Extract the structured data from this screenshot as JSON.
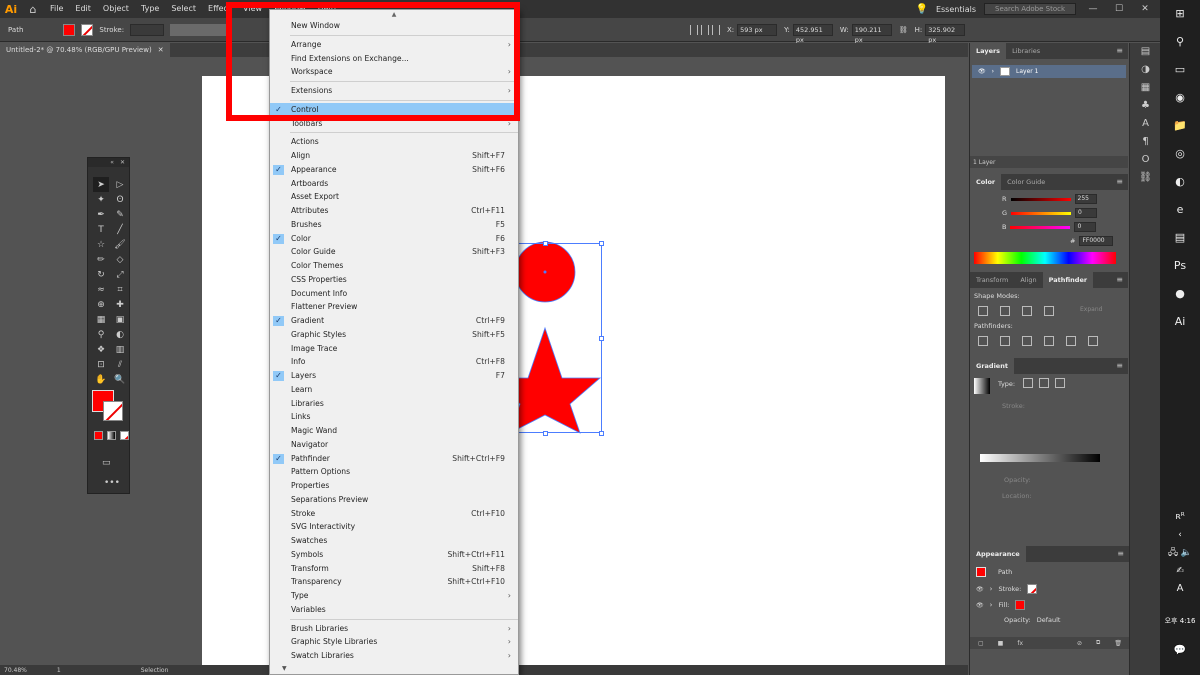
{
  "app": {
    "logo": "Ai",
    "menus": [
      "File",
      "Edit",
      "Object",
      "Type",
      "Select",
      "Effect",
      "View",
      "Window",
      "Help"
    ],
    "workspace": "Essentials",
    "search_placeholder": "Search Adobe Stock"
  },
  "control": {
    "selection_label": "Path",
    "stroke_label": "Stroke:",
    "x_label": "X:",
    "x": "593 px",
    "y_label": "Y:",
    "y": "452.951 px",
    "w_label": "W:",
    "w": "190.211 px",
    "h_label": "H:",
    "h": "325.902 px"
  },
  "document": {
    "tab_title": "Untitled-2* @ 70.48% (RGB/GPU Preview)",
    "zoom": "70.48%",
    "artboard_num": "1",
    "status": "Selection"
  },
  "window_menu": [
    {
      "label": "New Window"
    },
    {
      "sep": true
    },
    {
      "label": "Arrange",
      "sub": true
    },
    {
      "label": "Find Extensions on Exchange..."
    },
    {
      "label": "Workspace",
      "sub": true
    },
    {
      "sep": true
    },
    {
      "label": "Extensions",
      "sub": true
    },
    {
      "sep": true
    },
    {
      "label": "Control",
      "checked": true,
      "hl": true
    },
    {
      "label": "Toolbars",
      "sub": true
    },
    {
      "sep": true
    },
    {
      "label": "Actions"
    },
    {
      "label": "Align",
      "shortcut": "Shift+F7"
    },
    {
      "label": "Appearance",
      "shortcut": "Shift+F6",
      "checked": true
    },
    {
      "label": "Artboards"
    },
    {
      "label": "Asset Export"
    },
    {
      "label": "Attributes",
      "shortcut": "Ctrl+F11"
    },
    {
      "label": "Brushes",
      "shortcut": "F5"
    },
    {
      "label": "Color",
      "shortcut": "F6",
      "checked": true
    },
    {
      "label": "Color Guide",
      "shortcut": "Shift+F3"
    },
    {
      "label": "Color Themes"
    },
    {
      "label": "CSS Properties"
    },
    {
      "label": "Document Info"
    },
    {
      "label": "Flattener Preview"
    },
    {
      "label": "Gradient",
      "shortcut": "Ctrl+F9",
      "checked": true
    },
    {
      "label": "Graphic Styles",
      "shortcut": "Shift+F5"
    },
    {
      "label": "Image Trace"
    },
    {
      "label": "Info",
      "shortcut": "Ctrl+F8"
    },
    {
      "label": "Layers",
      "shortcut": "F7",
      "checked": true
    },
    {
      "label": "Learn"
    },
    {
      "label": "Libraries"
    },
    {
      "label": "Links"
    },
    {
      "label": "Magic Wand"
    },
    {
      "label": "Navigator"
    },
    {
      "label": "Pathfinder",
      "shortcut": "Shift+Ctrl+F9",
      "checked": true
    },
    {
      "label": "Pattern Options"
    },
    {
      "label": "Properties"
    },
    {
      "label": "Separations Preview"
    },
    {
      "label": "Stroke",
      "shortcut": "Ctrl+F10"
    },
    {
      "label": "SVG Interactivity"
    },
    {
      "label": "Swatches"
    },
    {
      "label": "Symbols",
      "shortcut": "Shift+Ctrl+F11"
    },
    {
      "label": "Transform",
      "shortcut": "Shift+F8"
    },
    {
      "label": "Transparency",
      "shortcut": "Shift+Ctrl+F10"
    },
    {
      "label": "Type",
      "sub": true
    },
    {
      "label": "Variables"
    },
    {
      "sep": true
    },
    {
      "label": "Brush Libraries",
      "sub": true
    },
    {
      "label": "Graphic Style Libraries",
      "sub": true
    },
    {
      "label": "Swatch Libraries",
      "sub": true
    }
  ],
  "layers_panel": {
    "tabs": [
      "Layers",
      "Libraries"
    ],
    "layer_name": "Layer 1",
    "footer": "1 Layer"
  },
  "color_panel": {
    "tabs": [
      "Color",
      "Color Guide"
    ],
    "r_label": "R",
    "r": "255",
    "g_label": "G",
    "g": "0",
    "b_label": "B",
    "b": "0",
    "hex_label": "#",
    "hex": "FF0000"
  },
  "pathfinder_panel": {
    "tabs": [
      "Transform",
      "Align",
      "Pathfinder"
    ],
    "shape_modes": "Shape Modes:",
    "expand": "Expand",
    "pathfinders": "Pathfinders:"
  },
  "gradient_panel": {
    "title": "Gradient",
    "type_label": "Type:",
    "stroke_label": "Stroke:",
    "opacity_label": "Opacity:",
    "location_label": "Location:"
  },
  "appearance_panel": {
    "title": "Appearance",
    "path": "Path",
    "stroke": "Stroke:",
    "fill": "Fill:",
    "opacity": "Opacity:",
    "opacity_value": "Default"
  },
  "taskbar": {
    "time_prefix": "오후",
    "time": "4:16",
    "lang": "A"
  },
  "colors": {
    "fill": "#ff0000",
    "selection": "#4c7dff",
    "highlight": "#91c9f7",
    "annotation": "#ff0000"
  }
}
